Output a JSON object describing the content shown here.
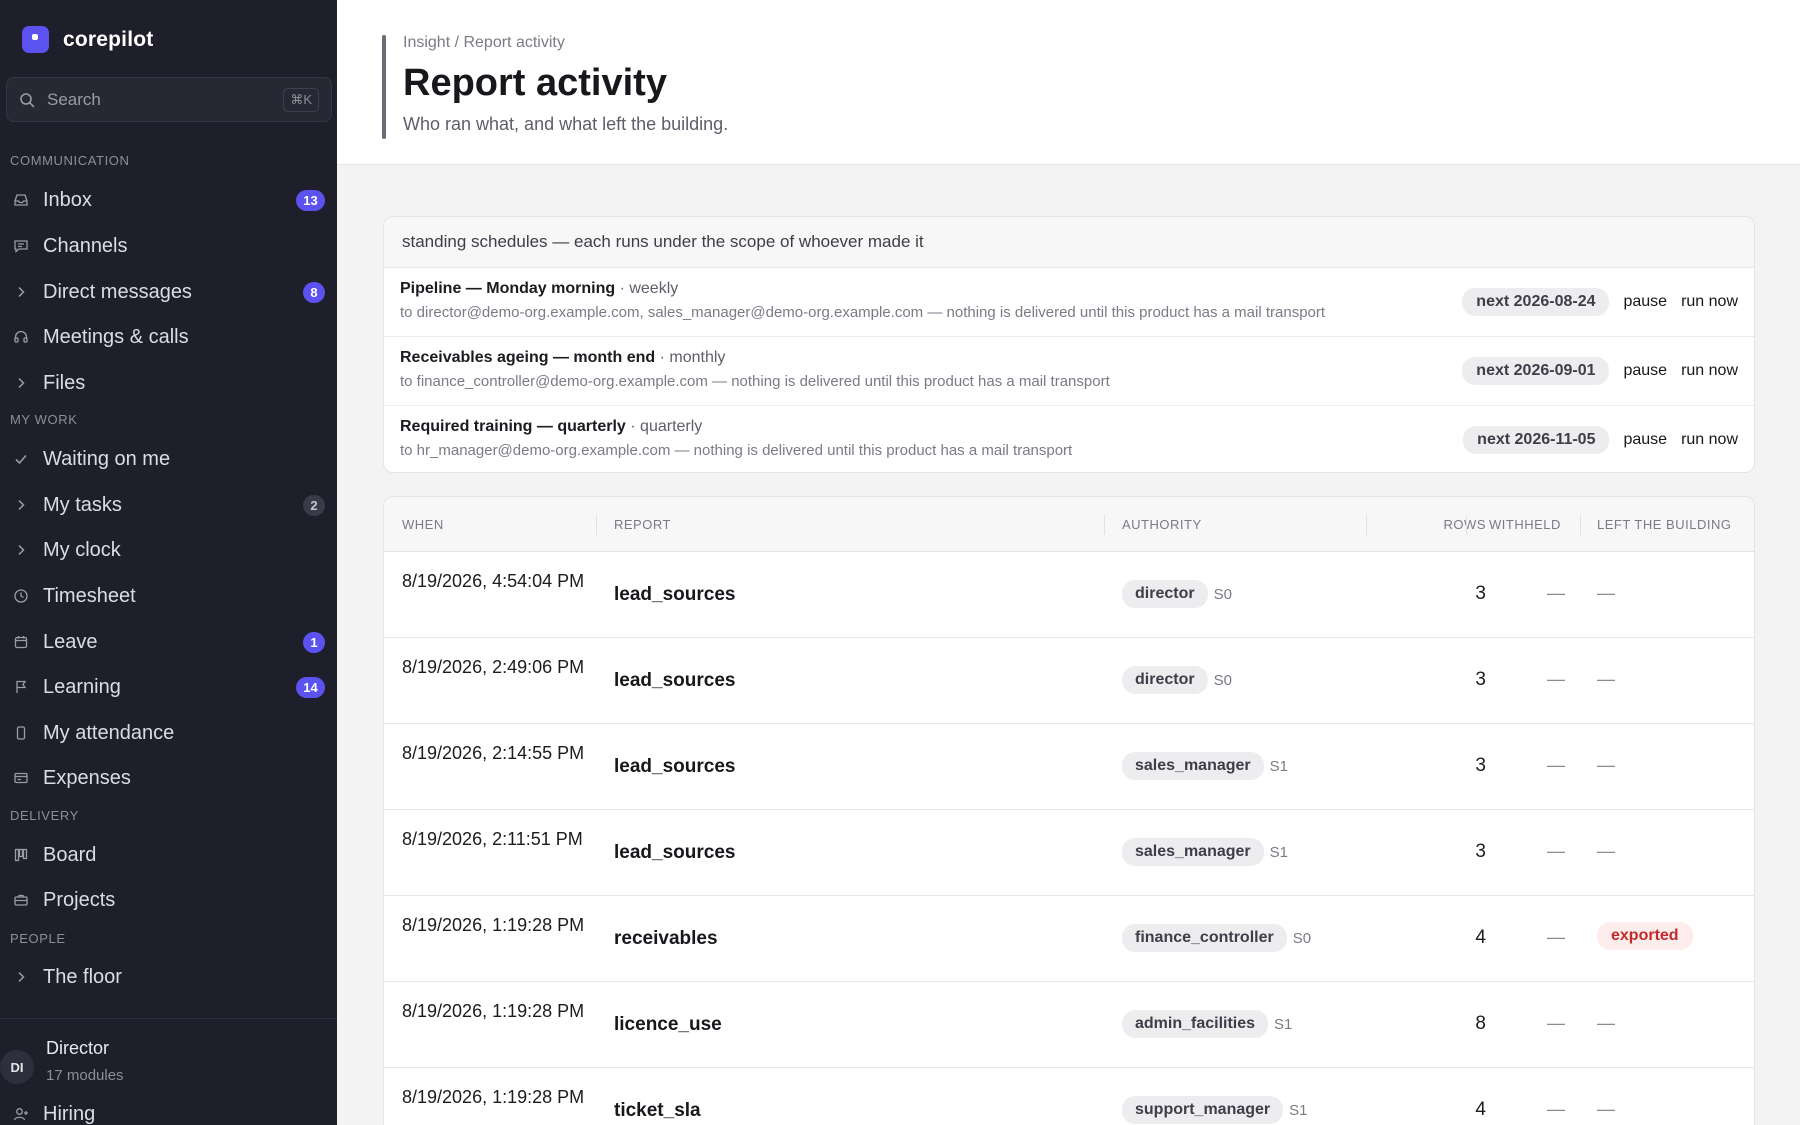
{
  "app": {
    "name": "corepilot"
  },
  "search": {
    "placeholder": "Search",
    "shortcut": "⌘K"
  },
  "sidebar": {
    "sections": {
      "communication": "COMMUNICATION",
      "my_work": "MY WORK",
      "delivery": "DELIVERY",
      "people": "PEOPLE"
    },
    "items": [
      {
        "label": "Inbox",
        "icon": "inbox-icon",
        "badge": "13"
      },
      {
        "label": "Channels",
        "icon": "chat-icon"
      },
      {
        "label": "Direct messages",
        "icon": "chevron-right-icon",
        "badge": "8"
      },
      {
        "label": "Meetings & calls",
        "icon": "headset-icon"
      },
      {
        "label": "Files",
        "icon": "chevron-right-icon"
      },
      {
        "label": "Waiting on me",
        "icon": "check-icon"
      },
      {
        "label": "My tasks",
        "icon": "chevron-right-icon",
        "badge": "2"
      },
      {
        "label": "My clock",
        "icon": "chevron-right-icon"
      },
      {
        "label": "Timesheet",
        "icon": "clock-icon"
      },
      {
        "label": "Leave",
        "icon": "calendar-icon",
        "badge": "1"
      },
      {
        "label": "Learning",
        "icon": "flag-icon",
        "badge": "14"
      },
      {
        "label": "My attendance",
        "icon": "phone-icon"
      },
      {
        "label": "Expenses",
        "icon": "receipt-icon"
      },
      {
        "label": "Board",
        "icon": "board-icon"
      },
      {
        "label": "Projects",
        "icon": "briefcase-icon"
      },
      {
        "label": "The floor",
        "icon": "chevron-right-icon"
      },
      {
        "label": "Hiring",
        "icon": "user-plus-icon"
      }
    ],
    "user": {
      "initials": "DI",
      "name": "Director",
      "sub": "17 modules"
    }
  },
  "header": {
    "breadcrumb": "Insight / Report activity",
    "title": "Report activity",
    "subtitle": "Who ran what, and what left the building."
  },
  "schedules": {
    "heading": "standing schedules — each runs under the scope of whoever made it",
    "rows": [
      {
        "name": "Pipeline — Monday morning",
        "freq": "· weekly",
        "to": "to director@demo-org.example.com, sales_manager@demo-org.example.com — nothing is delivered until this product has a mail transport",
        "next": "next 2026-08-24",
        "pause": "pause",
        "run": "run now"
      },
      {
        "name": "Receivables ageing — month end",
        "freq": "· monthly",
        "to": "to finance_controller@demo-org.example.com — nothing is delivered until this product has a mail transport",
        "next": "next 2026-09-01",
        "pause": "pause",
        "run": "run now"
      },
      {
        "name": "Required training — quarterly",
        "freq": "· quarterly",
        "to": "to hr_manager@demo-org.example.com — nothing is delivered until this product has a mail transport",
        "next": "next 2026-11-05",
        "pause": "pause",
        "run": "run now"
      }
    ]
  },
  "activity": {
    "columns": {
      "when": "WHEN",
      "report": "REPORT",
      "authority": "AUTHORITY",
      "rows": "ROWS",
      "withheld": "WITHHELD",
      "left": "LEFT THE BUILDING"
    },
    "rows": [
      {
        "when": "8/19/2026, 4:54:04 PM",
        "report": "lead_sources",
        "role": "director",
        "scope": "S0",
        "rows": "3",
        "withheld": "—",
        "left": "—"
      },
      {
        "when": "8/19/2026, 2:49:06 PM",
        "report": "lead_sources",
        "role": "director",
        "scope": "S0",
        "rows": "3",
        "withheld": "—",
        "left": "—"
      },
      {
        "when": "8/19/2026, 2:14:55 PM",
        "report": "lead_sources",
        "role": "sales_manager",
        "scope": "S1",
        "rows": "3",
        "withheld": "—",
        "left": "—"
      },
      {
        "when": "8/19/2026, 2:11:51 PM",
        "report": "lead_sources",
        "role": "sales_manager",
        "scope": "S1",
        "rows": "3",
        "withheld": "—",
        "left": "—"
      },
      {
        "when": "8/19/2026, 1:19:28 PM",
        "report": "receivables",
        "role": "finance_controller",
        "scope": "S0",
        "rows": "4",
        "withheld": "—",
        "left": "exported"
      },
      {
        "when": "8/19/2026, 1:19:28 PM",
        "report": "licence_use",
        "role": "admin_facilities",
        "scope": "S1",
        "rows": "8",
        "withheld": "—",
        "left": "—"
      },
      {
        "when": "8/19/2026, 1:19:28 PM",
        "report": "ticket_sla",
        "role": "support_manager",
        "scope": "S1",
        "rows": "4",
        "withheld": "—",
        "left": "—"
      }
    ]
  },
  "colors": {
    "accent": "#5b52f0",
    "sidebar": "#1e1f2a",
    "exported_bg": "#fdecec",
    "exported_fg": "#c22b2b"
  }
}
